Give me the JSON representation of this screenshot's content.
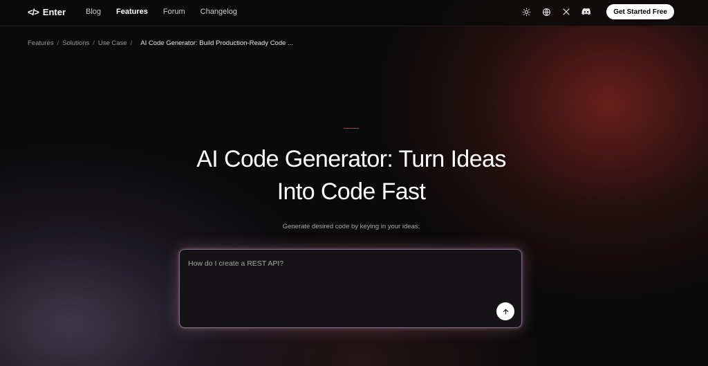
{
  "brand": {
    "logo_glyph": "</>",
    "name": "Enter"
  },
  "nav": {
    "links": [
      {
        "label": "Blog",
        "active": false
      },
      {
        "label": "Features",
        "active": true
      },
      {
        "label": "Forum",
        "active": false
      },
      {
        "label": "Changelog",
        "active": false
      }
    ],
    "icons": [
      "sun-icon",
      "globe-icon",
      "x-logo-icon",
      "discord-icon"
    ],
    "cta_label": "Get Started Free"
  },
  "breadcrumb": {
    "items": [
      "Features",
      "Solutions",
      "Use Case"
    ],
    "separator": "/",
    "current": "AI Code Generator: Build Production-Ready Code ..."
  },
  "hero": {
    "title_line1": "AI Code Generator: Turn Ideas",
    "title_line2": "Into Code Fast",
    "subtitle": "Generate desired code by keying in your ideas:"
  },
  "prompt": {
    "value": "",
    "placeholder": "How do I create a REST API?",
    "send_icon": "arrow-up-icon"
  },
  "colors": {
    "accent_line": "#a8443a",
    "prompt_border": "#7b6a86",
    "cta_bg": "#ffffff"
  }
}
